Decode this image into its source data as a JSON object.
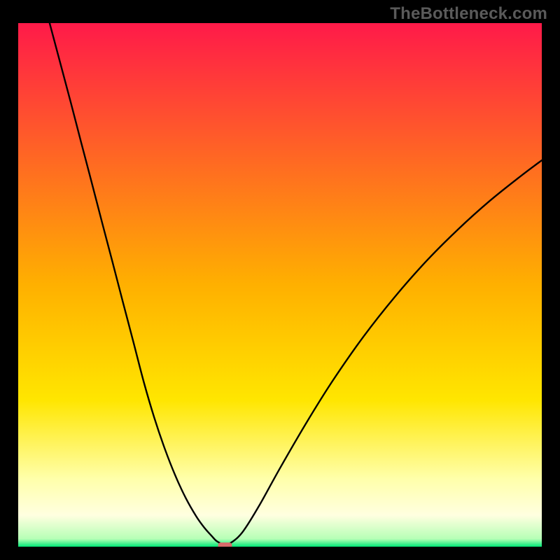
{
  "watermark": "TheBottleneck.com",
  "chart_data": {
    "type": "line",
    "title": "",
    "xlabel": "",
    "ylabel": "",
    "xlim": [
      0,
      100
    ],
    "ylim": [
      0,
      100
    ],
    "grid": false,
    "background_gradient": {
      "stops": [
        {
          "offset": 0.0,
          "color": "#ff1a49"
        },
        {
          "offset": 0.5,
          "color": "#ffb000"
        },
        {
          "offset": 0.72,
          "color": "#ffe600"
        },
        {
          "offset": 0.87,
          "color": "#ffffaa"
        },
        {
          "offset": 0.94,
          "color": "#ffffe0"
        },
        {
          "offset": 0.985,
          "color": "#b6ffb6"
        },
        {
          "offset": 1.0,
          "color": "#00e676"
        }
      ]
    },
    "minimum_marker": {
      "x": 39.5,
      "y": 0,
      "color": "#d86b6b"
    },
    "series": [
      {
        "name": "bottleneck-curve",
        "color": "#000000",
        "x": [
          6.0,
          8.0,
          10.0,
          12.0,
          14.0,
          16.0,
          18.0,
          20.0,
          22.0,
          24.0,
          26.0,
          28.0,
          30.0,
          32.0,
          34.0,
          35.5,
          37.0,
          38.0,
          39.5,
          41.0,
          43.0,
          46.0,
          50.0,
          55.0,
          60.0,
          66.0,
          72.0,
          78.0,
          84.0,
          90.0,
          96.0,
          100.0
        ],
        "y": [
          100.0,
          92.5,
          85.0,
          77.3,
          69.7,
          62.0,
          54.4,
          46.7,
          39.1,
          31.4,
          24.6,
          18.7,
          13.6,
          9.3,
          5.8,
          3.7,
          2.0,
          1.0,
          0.4,
          1.0,
          3.0,
          7.8,
          15.0,
          23.6,
          31.6,
          40.2,
          47.8,
          54.6,
          60.6,
          66.0,
          70.8,
          73.8
        ]
      }
    ]
  }
}
